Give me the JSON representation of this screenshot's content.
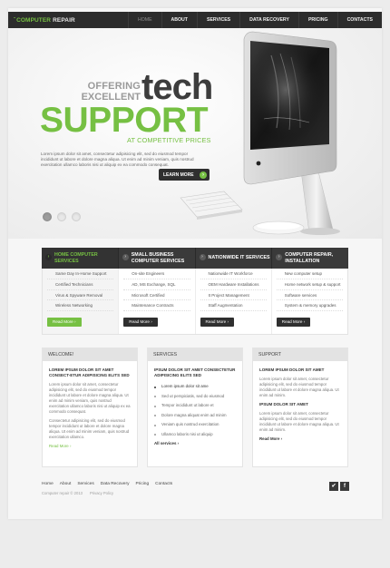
{
  "header": {
    "logo_mark": "ˇ",
    "logo_a": "COMPUTER",
    "logo_b": "REPAIR",
    "nav": [
      "HOME",
      "ABOUT",
      "SERVICES",
      "DATA RECOVERY",
      "PRICING",
      "CONTACTS"
    ],
    "active_nav": "HOME"
  },
  "hero": {
    "offering": "OFFERING",
    "excellent": "EXCELLENT",
    "tech": "tech",
    "support": "SUPPORT",
    "prices": "AT COMPETITIVE PRICES",
    "description": "Lorem ipsum dolor sit amet, consectetur adipisicing elit, sed do eiusmod tempor incididunt ut labore et dolore magna aliqua. Ut enim ad minim veniam, quis nostrud exercitation ullamco laboris nisi ut aliquip ex ea commodo consequat.",
    "button": "LEARN MORE",
    "slider_dots": 3,
    "active_slide": 1
  },
  "services": {
    "columns": [
      {
        "title": "HOME COMPUTER SERVICES",
        "items": [
          "Same Day In-Home Support",
          "Certified Technicians",
          "Virus & Spyware Removal",
          "Wireless Networking"
        ],
        "more": "Read More ›"
      },
      {
        "title": "SMALL BUSINESS COMPUTER SERVICES",
        "items": [
          "On-site Engineers",
          "AD, MS Exchange, SQL",
          "Microsoft Certified",
          "Maintenance Contracts"
        ],
        "more": "Read More ›"
      },
      {
        "title": "NATIONWIDE IT SERVICES",
        "items": [
          "Nationwide IT Workforce",
          "OEM Hardware Installations",
          "It Project Management",
          "Staff Augmentation"
        ],
        "more": "Read More ›"
      },
      {
        "title": "COMPUTER REPAIR, INSTALLATION",
        "items": [
          "New computer setup",
          "Home network setup & support",
          "Software services",
          "System & memory upgrades"
        ],
        "more": "Read More ›"
      }
    ]
  },
  "welcome": {
    "title": "WELCOME!",
    "heading": "LOREM IPSUM DOLOR SIT AMET CONSECT-ETUR ADIPISICING ELITS SED",
    "text1": "Lorem ipsum dolor sit amet, consectetur adipisicing elit, sed do eiusmod tempor incididunt ut labore et dolore magna aliqua. Ut enim ad minim veniam, quis nostrud exercitation ullamco laboris nisi ut aliquip ex ea commodo consequat.",
    "text2": "Consectetur adipisicing elit, sed do eiusmod tempor incididunt ut labore et dolore magna aliqua. Ut enim ad minim veniam, quis nostrud exercitation ullamco.",
    "link": "Read More ›"
  },
  "services_box": {
    "title": "SERVICES",
    "heading": "IPSUM DOLOR SIT AMET CONSECTETUR ADIPISICING ELITS SED",
    "items": [
      "Lorem ipsum dolor sit ame",
      "Sed ut perspiciatis, sed do eiusmod",
      "Tempor incididunt ut labore et",
      "Dolore magna aliquat enim ad minim",
      "Veniam quis nostrud exercitation",
      "Ullamco laboris nisi ut aliquip"
    ],
    "link": "All services ›"
  },
  "support_box": {
    "title": "SUPPORT",
    "heading1": "LOREM IPSUM DOLOR SIT AMET",
    "text1": "Lorem ipsum dolor sit amet, consectetur adipisicing elit, sed do eiusmod tempor incididunt ut labore et dolore magna aliqua. Ut enim ad minim.",
    "heading2": "IPSUM DOLOR SIT AMET",
    "text2": "Lorem ipsum dolor sit amet, consectetur adipisicing elit, sed do eiusmod tempor incididunt ut labore et dolore magna aliqua. Ut enim ad minim.",
    "link": "Read More ›"
  },
  "footer": {
    "nav": [
      "Home",
      "About",
      "Services",
      "Data Recovery",
      "Pricing",
      "Contacts"
    ],
    "copyright": "Computer repair © 2013",
    "privacy": "Privacy Policy",
    "social": [
      "✔",
      "f"
    ]
  },
  "colors": {
    "accent": "#76c043",
    "dark": "#2c2c2c",
    "background": "#ececec"
  }
}
